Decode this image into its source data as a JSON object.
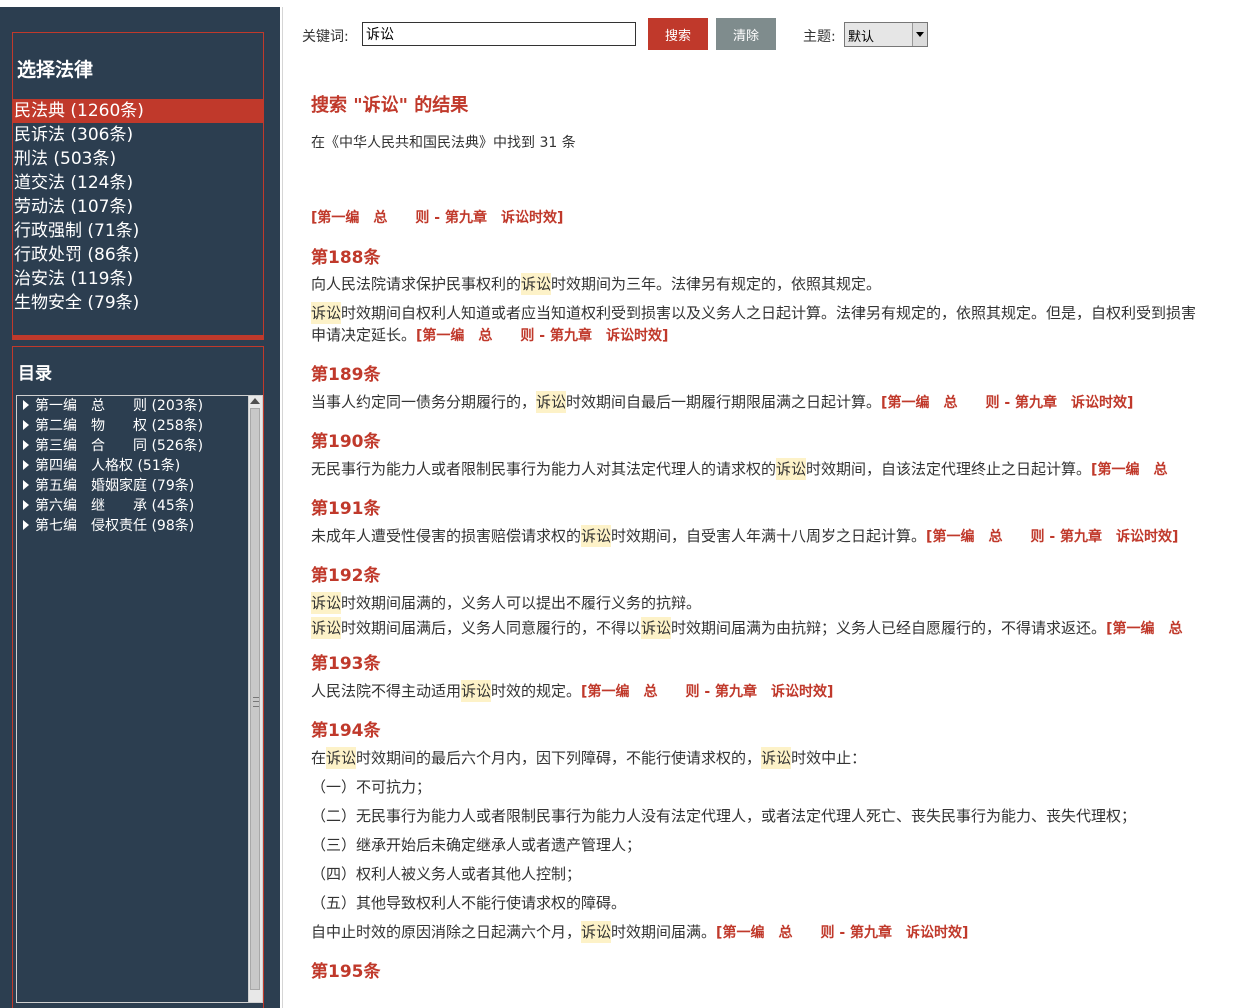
{
  "sidebar": {
    "law_heading": "选择法律",
    "laws": [
      {
        "label": "民法典 (1260条)",
        "active": true
      },
      {
        "label": "民诉法 (306条)"
      },
      {
        "label": "刑法 (503条)"
      },
      {
        "label": "道交法 (124条)"
      },
      {
        "label": "劳动法 (107条)"
      },
      {
        "label": "行政强制 (71条)"
      },
      {
        "label": "行政处罚 (86条)"
      },
      {
        "label": "治安法 (119条)"
      },
      {
        "label": "生物安全 (79条)"
      }
    ],
    "toc_heading": "目录",
    "toc": [
      "第一编　总　　则 (203条)",
      "第二编　物　　权 (258条)",
      "第三编　合　　同 (526条)",
      "第四编　人格权 (51条)",
      "第五编　婚姻家庭 (79条)",
      "第六编　继　　承 (45条)",
      "第七编　侵权责任 (98条)"
    ]
  },
  "toolbar": {
    "keyword_label": "关键词:",
    "keyword_value": "诉讼",
    "search_label": "搜索",
    "clear_label": "清除",
    "theme_label": "主题:",
    "theme_value": "默认"
  },
  "results": {
    "title": "搜索 \"诉讼\" 的结果",
    "summary": "在《中华人民共和国民法典》中找到 31 条",
    "section_head": "[第一编　总　　则 - 第九章　诉讼时效]",
    "source": "[第一编　总　　则 - 第九章　诉讼时效]",
    "source_cut": "[第一编　总",
    "keyword": "诉讼",
    "articles": {
      "a188": {
        "title": "第188条",
        "l1a": "向人民法院请求保护民事权利的",
        "l1b": "时效期间为三年。法律另有规定的，依照其规定。",
        "l2b": "时效期间自权利人知道或者应当知道权利受到损害以及义务人之日起计算。法律另有规定的，依照其规定。但是，自权利受到损害",
        "l3": "申请决定延长。"
      },
      "a189": {
        "title": "第189条",
        "l1a": "当事人约定同一债务分期履行的，",
        "l1b": "时效期间自最后一期履行期限届满之日起计算。"
      },
      "a190": {
        "title": "第190条",
        "l1a": "无民事行为能力人或者限制民事行为能力人对其法定代理人的请求权的",
        "l1b": "时效期间，自该法定代理终止之日起计算。"
      },
      "a191": {
        "title": "第191条",
        "l1a": "未成年人遭受性侵害的损害赔偿请求权的",
        "l1b": "时效期间，自受害人年满十八周岁之日起计算。"
      },
      "a192": {
        "title": "第192条",
        "l1b": "时效期间届满的，义务人可以提出不履行义务的抗辩。",
        "l2b": "时效期间届满后，义务人同意履行的，不得以",
        "l2d": "时效期间届满为由抗辩；义务人已经自愿履行的，不得请求返还。"
      },
      "a193": {
        "title": "第193条",
        "l1a": "人民法院不得主动适用",
        "l1b": "时效的规定。"
      },
      "a194": {
        "title": "第194条",
        "l1a": "在",
        "l1b": "时效期间的最后六个月内，因下列障碍，不能行使请求权的，",
        "l1d": "时效中止：",
        "items": [
          "（一）不可抗力；",
          "（二）无民事行为能力人或者限制民事行为能力人没有法定代理人，或者法定代理人死亡、丧失民事行为能力、丧失代理权；",
          "（三）继承开始后未确定继承人或者遗产管理人；",
          "（四）权利人被义务人或者其他人控制；",
          "（五）其他导致权利人不能行使请求权的障碍。"
        ],
        "last_a": "自中止时效的原因消除之日起满六个月，",
        "last_b": "时效期间届满。"
      },
      "a195": {
        "title": "第195条"
      }
    }
  },
  "colors": {
    "sidebar_bg": "#2c3e50",
    "accent": "#c0392b",
    "clear_button": "#7f8c8d",
    "highlight": "#fdf2c8"
  }
}
